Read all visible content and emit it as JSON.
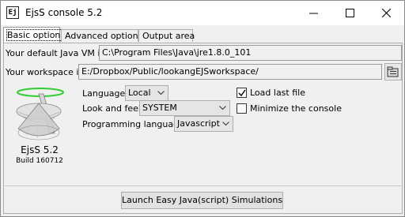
{
  "window": {
    "title": "EjsS console 5.2",
    "icon_text": "Ej",
    "controls": [
      "minimize-icon",
      "maximize-icon",
      "close-icon"
    ]
  },
  "tabs": [
    {
      "label": "Basic options",
      "selected": true
    },
    {
      "label": "Advanced options",
      "selected": false
    },
    {
      "label": "Output area",
      "selected": false
    }
  ],
  "basic": {
    "java_vm_label": "Your default Java VM is:",
    "java_vm_value": "C:\\Program Files\\Java\\jre1.8.0_101",
    "workspace_label": "Your workspace is:",
    "workspace_value": "E:/Dropbox/Public/lookangEJSworkspace/",
    "browse_icon": "folder-browse-icon",
    "language_label": "Language:",
    "language_value": "Local",
    "look_label": "Look and feel:",
    "look_value": "SYSTEM",
    "proglang_label": "Programming language:",
    "proglang_value": "Javascript",
    "load_last_file_label": "Load last file",
    "load_last_file_checked": true,
    "minimize_console_label": "Minimize the console",
    "minimize_console_checked": false,
    "version": "EjsS 5.2",
    "build": "Build 160712"
  },
  "launch_label": "Launch Easy Java(script) Simulations"
}
